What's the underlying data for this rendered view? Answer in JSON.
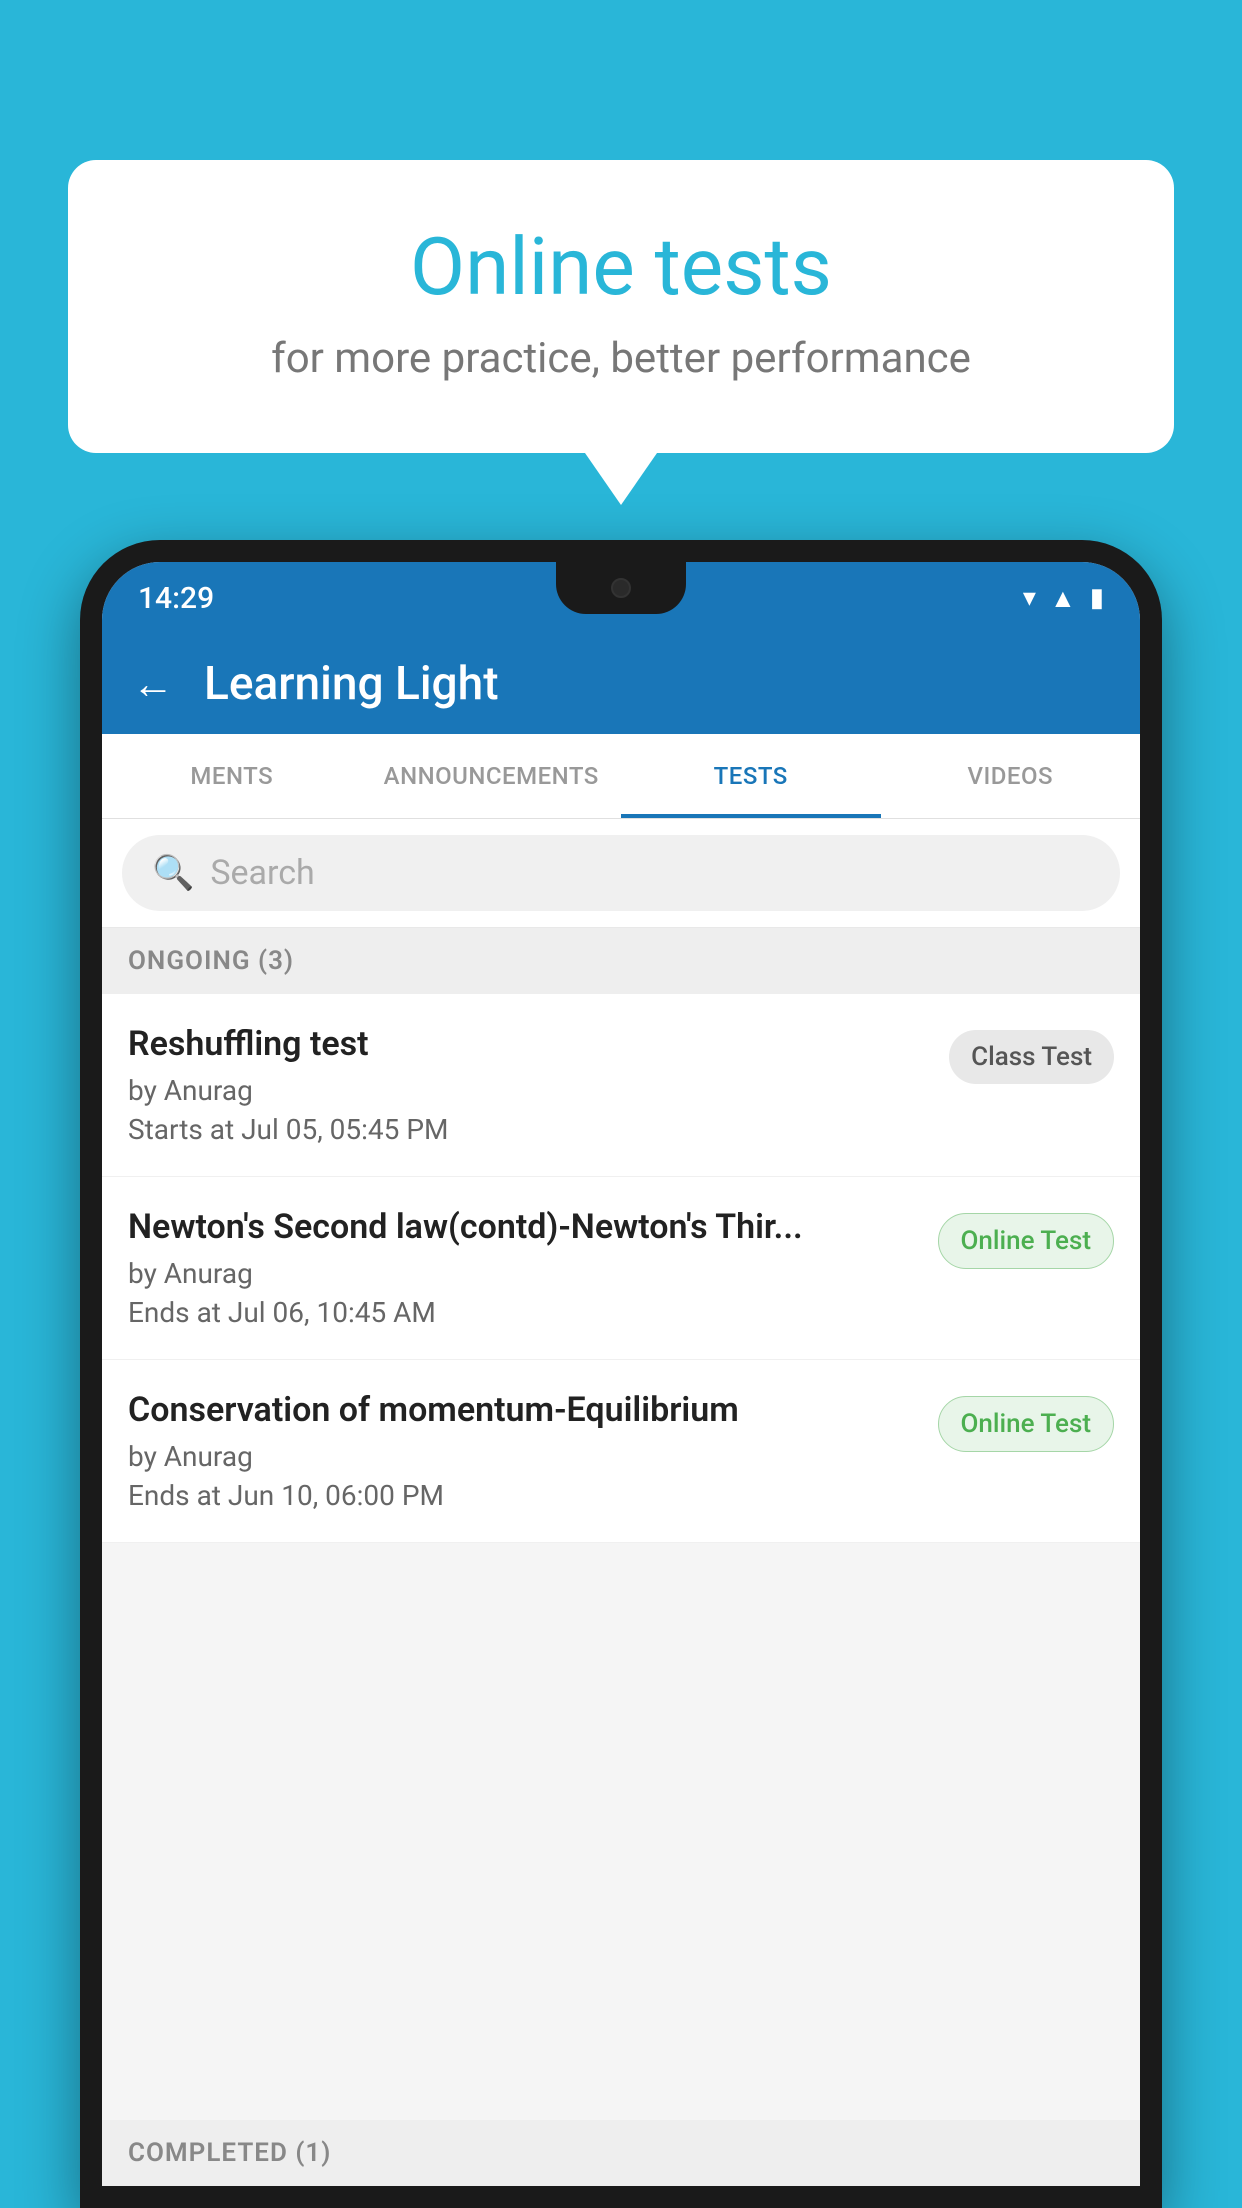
{
  "background_color": "#29b6d8",
  "speech_bubble": {
    "title": "Online tests",
    "subtitle": "for more practice, better performance"
  },
  "phone": {
    "status_bar": {
      "time": "14:29",
      "icons": [
        "wifi",
        "signal",
        "battery"
      ]
    },
    "app_header": {
      "title": "Learning Light",
      "back_button_label": "←"
    },
    "tabs": [
      {
        "label": "MENTS",
        "active": false
      },
      {
        "label": "ANNOUNCEMENTS",
        "active": false
      },
      {
        "label": "TESTS",
        "active": true
      },
      {
        "label": "VIDEOS",
        "active": false
      }
    ],
    "search": {
      "placeholder": "Search"
    },
    "sections": [
      {
        "label": "ONGOING (3)",
        "tests": [
          {
            "name": "Reshuffling test",
            "author": "by Anurag",
            "time_label": "Starts at",
            "time_value": "Jul 05, 05:45 PM",
            "badge": "Class Test",
            "badge_type": "class"
          },
          {
            "name": "Newton's Second law(contd)-Newton's Thir...",
            "author": "by Anurag",
            "time_label": "Ends at",
            "time_value": "Jul 06, 10:45 AM",
            "badge": "Online Test",
            "badge_type": "online"
          },
          {
            "name": "Conservation of momentum-Equilibrium",
            "author": "by Anurag",
            "time_label": "Ends at",
            "time_value": "Jun 10, 06:00 PM",
            "badge": "Online Test",
            "badge_type": "online"
          }
        ]
      }
    ],
    "completed_section_label": "COMPLETED (1)"
  }
}
